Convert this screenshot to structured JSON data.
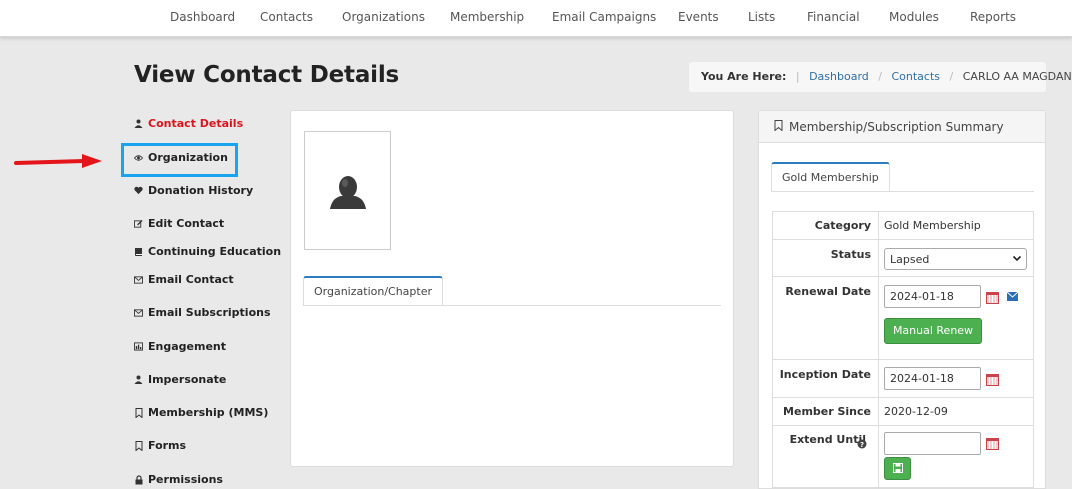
{
  "nav": [
    "Dashboard",
    "Contacts",
    "Organizations",
    "Membership",
    "Email Campaigns",
    "Events",
    "Lists",
    "Financial",
    "Modules",
    "Reports"
  ],
  "page_title": "View Contact Details",
  "breadcrumb": {
    "lead": "You Are Here:",
    "items": [
      "Dashboard",
      "Contacts"
    ],
    "current": "CARLO AA MAGDANGAL"
  },
  "sidebar": [
    {
      "label": "Contact Details",
      "icon": "user-icon",
      "active": true
    },
    {
      "label": "Organization",
      "icon": "eye-icon",
      "active": false
    },
    {
      "label": "Donation History",
      "icon": "heart-icon",
      "active": false
    },
    {
      "label": "Edit Contact",
      "icon": "edit-icon",
      "active": false
    },
    {
      "label": "Continuing Education",
      "icon": "book-icon",
      "active": false
    },
    {
      "label": "Email Contact",
      "icon": "envelope-icon",
      "active": false
    },
    {
      "label": "Email Subscriptions",
      "icon": "envelope-icon",
      "active": false
    },
    {
      "label": "Engagement",
      "icon": "chart-icon",
      "active": false
    },
    {
      "label": "Impersonate",
      "icon": "user-icon",
      "active": false
    },
    {
      "label": "Membership (MMS)",
      "icon": "bookmark-icon",
      "active": false
    },
    {
      "label": "Forms",
      "icon": "bookmark-icon",
      "active": false
    },
    {
      "label": "Permissions",
      "icon": "lock-icon",
      "active": false
    }
  ],
  "center": {
    "tab_label": "Organization/Chapter"
  },
  "summary": {
    "title": "Membership/Subscription Summary",
    "tab_label": "Gold Membership",
    "category_label": "Category",
    "category_value": "Gold Membership",
    "status_label": "Status",
    "status_value": "Lapsed",
    "renewal_label": "Renewal Date",
    "renewal_value": "2024-01-18",
    "manual_renew_label": "Manual Renew",
    "inception_label": "Inception Date",
    "inception_value": "2024-01-18",
    "member_since_label": "Member Since",
    "member_since_value": "2020-12-09",
    "extend_label": "Extend Until",
    "extend_value": ""
  },
  "colors": {
    "accent_blue": "#2e7bbf",
    "active_red": "#d9161c",
    "highlight_blue": "#1aa3ef",
    "arrow_red": "#e3151a",
    "green": "#4caf50"
  }
}
